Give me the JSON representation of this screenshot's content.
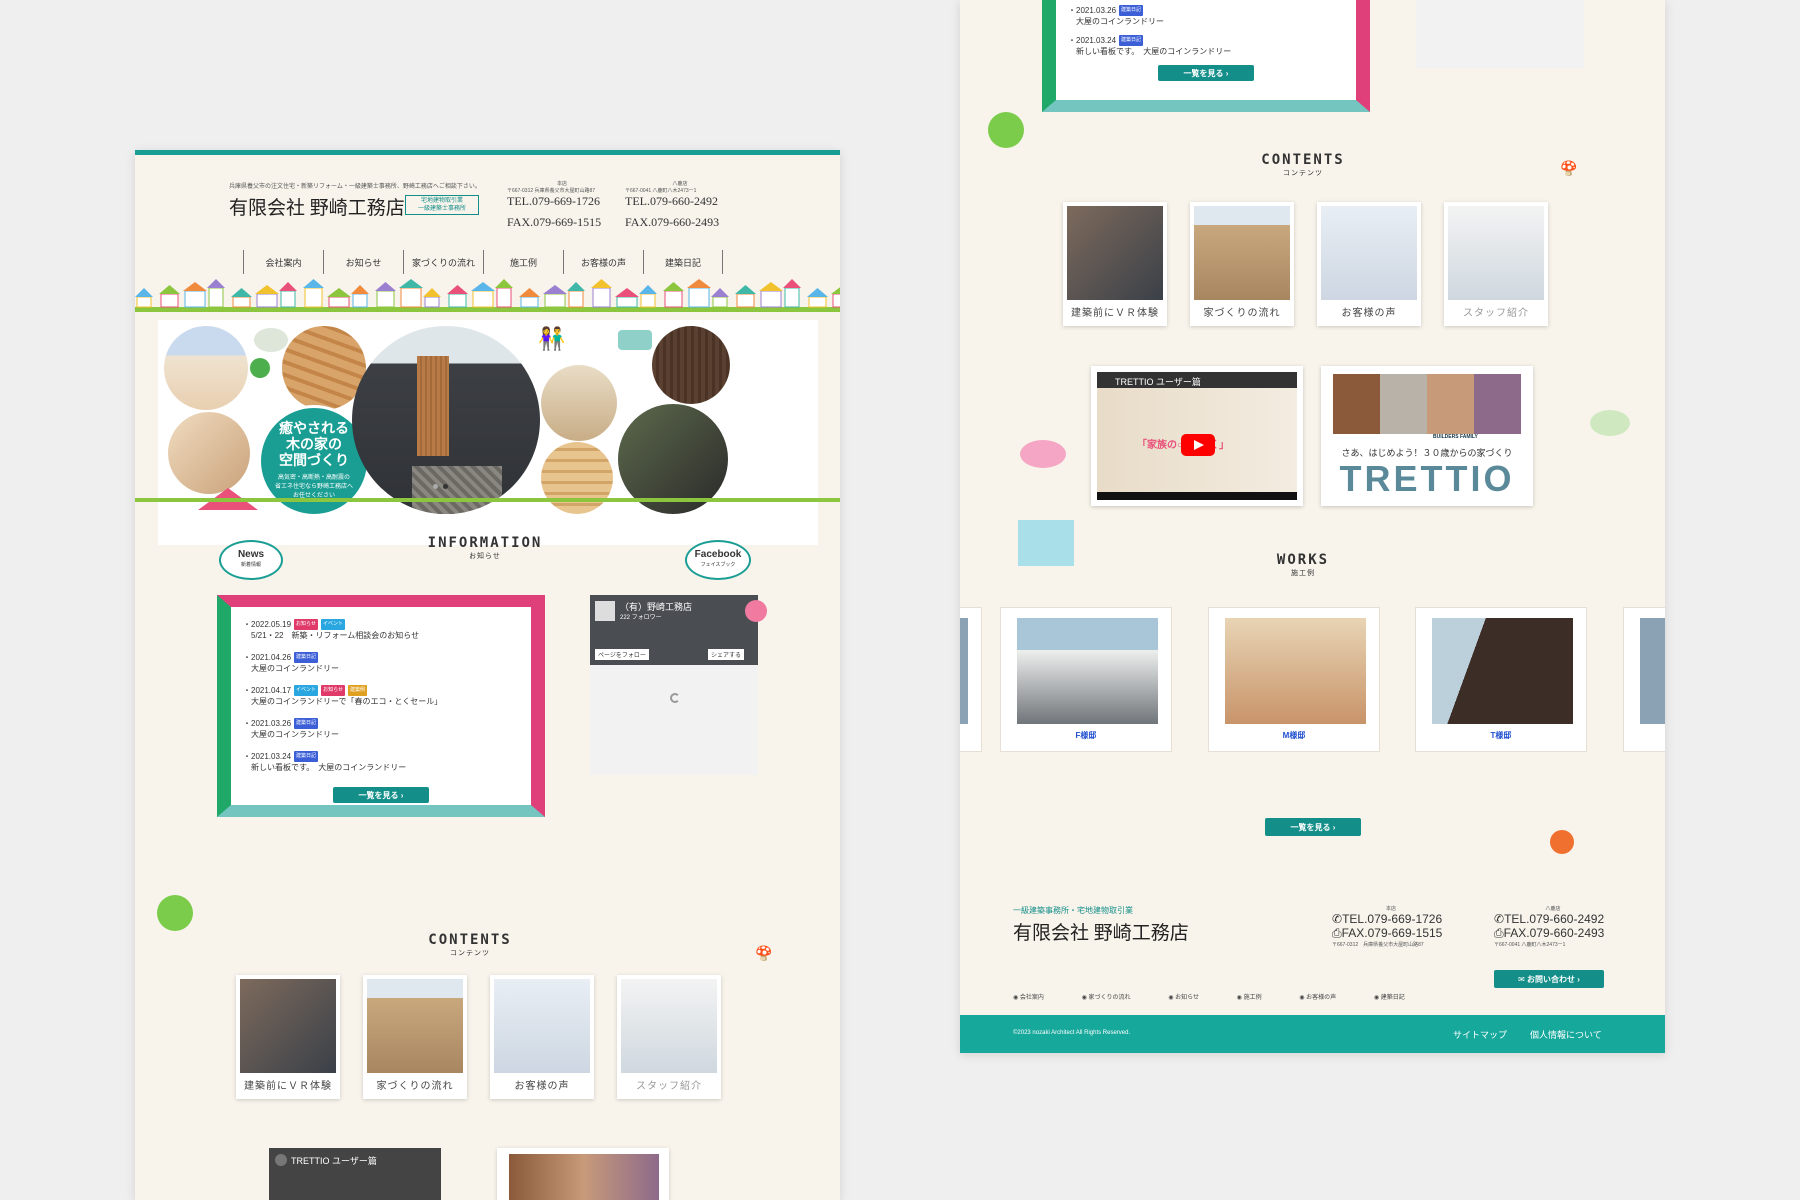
{
  "left": {
    "tagline": "兵庫県養父市の注文住宅・新築リフォーム・一級建築士事務所、野崎工務店へご相談下さい。",
    "company_name": "有限会社 野崎工務店",
    "license_badge": [
      "宅地建物取引業",
      "一級建築士事務所"
    ],
    "office1": {
      "name": "本店",
      "address": "〒667-0312 兵庫県養父市大屋町山路87",
      "tel": "TEL.079-669-1726",
      "fax": "FAX.079-669-1515"
    },
    "office2": {
      "name": "八鹿店",
      "address": "〒667-0041 八鹿町八木2473ー1",
      "tel": "TEL.079-660-2492",
      "fax": "FAX.079-660-2493"
    },
    "nav": [
      "会社案内",
      "お知らせ",
      "家づくりの流れ",
      "施工例",
      "お客様の声",
      "建築日記"
    ],
    "hero": {
      "headline": [
        "癒やされる",
        "木の家の",
        "空間づくり"
      ],
      "sub": [
        "高気密・高断熱・高耐震の",
        "省エネ住宅なら野崎工務店へ",
        "お任せください"
      ]
    },
    "info": {
      "title": "INFORMATION",
      "title_sub": "お知らせ",
      "news_bubble": "News",
      "news_bubble_sub": "新着情報",
      "fb_bubble": "Facebook",
      "fb_bubble_sub": "フェイスブック",
      "items": [
        {
          "date": "2022.05.19",
          "tags": [
            {
              "t": "お知らせ",
              "c": "#e03a6a"
            },
            {
              "t": "イベント",
              "c": "#2aa7e0"
            }
          ],
          "text": "5/21・22　新築・リフォーム相談会のお知らせ"
        },
        {
          "date": "2021.04.26",
          "tags": [
            {
              "t": "建築日記",
              "c": "#3c5fd8"
            }
          ],
          "text": "大屋のコインランドリー"
        },
        {
          "date": "2021.04.17",
          "tags": [
            {
              "t": "イベント",
              "c": "#2aa7e0"
            },
            {
              "t": "お知らせ",
              "c": "#e03a6a"
            },
            {
              "t": "建築例",
              "c": "#e0a020"
            }
          ],
          "text": "大屋のコインランドリーで「春のエコ・とくセール」"
        },
        {
          "date": "2021.03.26",
          "tags": [
            {
              "t": "建築日記",
              "c": "#3c5fd8"
            }
          ],
          "text": "大屋のコインランドリー"
        },
        {
          "date": "2021.03.24",
          "tags": [
            {
              "t": "建築日記",
              "c": "#3c5fd8"
            }
          ],
          "text": "新しい看板です。　大屋のコインランドリー"
        }
      ],
      "more_button": "一覧を見る"
    },
    "fb": {
      "page_name": "（有）野崎工務店",
      "followers": "222 フォロワー",
      "follow": "ページをフォロー",
      "share": "シェアする"
    },
    "contents": {
      "title": "CONTENTS",
      "title_sub": "コンテンツ",
      "cards": [
        "建築前にＶＲ体験",
        "家づくりの流れ",
        "お客様の声",
        "スタッフ紹介"
      ]
    },
    "video_title": "TRETTIO ユーザー篇"
  },
  "right": {
    "news_tail": [
      {
        "date": "2021.03.26",
        "tag": "建築日記",
        "text": "大屋のコインランドリー"
      },
      {
        "date": "2021.03.24",
        "tag": "建築日記",
        "text": "新しい看板です。　大屋のコインランドリー"
      }
    ],
    "more_button": "一覧を見る",
    "contents": {
      "title": "CONTENTS",
      "title_sub": "コンテンツ",
      "cards": [
        "建築前にＶＲ体験",
        "家づくりの流れ",
        "お客様の声",
        "スタッフ紹介"
      ]
    },
    "video": {
      "title": "TRETTIO ユーザー篇",
      "overlay": "「家族の○○を築く」"
    },
    "trettio": {
      "small": "BUILDERS FAMILY",
      "tagline": "さあ、はじめよう！３０歳からの家づくり",
      "logo": "TRETTIO"
    },
    "works": {
      "title": "WORKS",
      "title_sub": "施工例",
      "items": [
        "F様邸",
        "M様邸",
        "T様邸"
      ],
      "more_button": "一覧を見る"
    },
    "footer": {
      "license": "一級建築事務所・宅地建物取引業",
      "company": "有限会社 野崎工務店",
      "office1": {
        "name": "本店",
        "tel": "TEL.079-669-1726",
        "fax": "FAX.079-669-1515",
        "address": "〒667-0312　兵庫県養父市大屋町山路87"
      },
      "office2": {
        "name": "八鹿店",
        "tel": "TEL.079-660-2492",
        "fax": "FAX.079-660-2493",
        "address": "〒667-0041 八鹿町八木2473ー1"
      },
      "contact_button": "お問い合わせ",
      "links": [
        "会社案内",
        "家づくりの流れ",
        "お知らせ",
        "施工例",
        "お客様の声",
        "建築日記"
      ],
      "copyright": "©2023 nozaki Architect All Rights Reserved.",
      "sitemap": "サイトマップ",
      "privacy": "個人情報について"
    }
  },
  "colors": {
    "teal": "#138e88",
    "green": "#8cc63f",
    "pink": "#e0407a"
  }
}
